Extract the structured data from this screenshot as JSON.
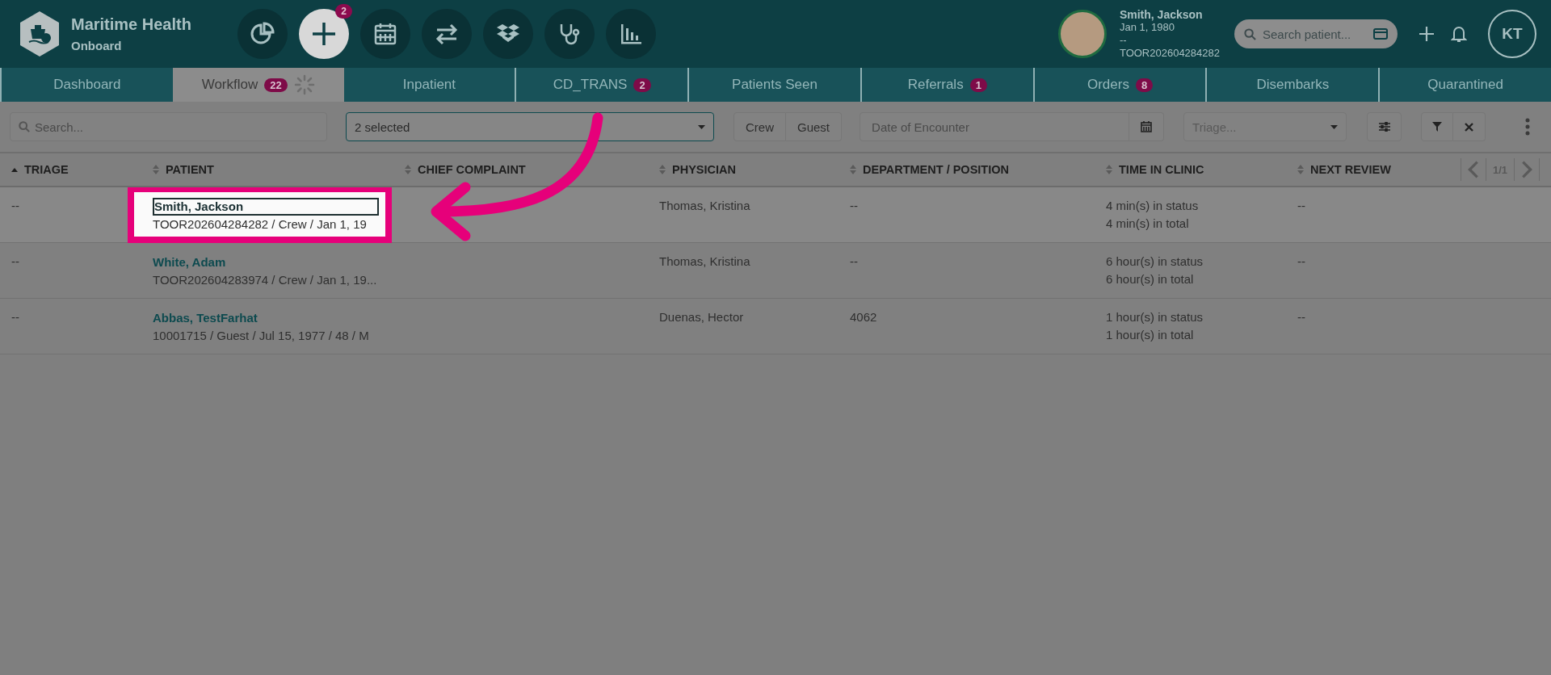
{
  "app": {
    "title": "Maritime Health",
    "subtitle": "Onboard"
  },
  "toolbar_buttons": [
    {
      "kind": "pie"
    },
    {
      "kind": "plus",
      "badge": "2"
    },
    {
      "kind": "calendar"
    },
    {
      "kind": "transfer"
    },
    {
      "kind": "boxes"
    },
    {
      "kind": "stethoscope"
    },
    {
      "kind": "bars"
    }
  ],
  "patient_banner": {
    "name": "Smith, Jackson",
    "dob": "Jan 1, 1980",
    "line_3": "--",
    "id": "TOOR202604284282"
  },
  "patient_search": {
    "placeholder": "Search patient..."
  },
  "user": {
    "initials": "KT"
  },
  "tabs": [
    {
      "label": "Dashboard",
      "selected": false,
      "loading": false
    },
    {
      "label": "Workflow",
      "badge": "22",
      "selected": true,
      "loading": true
    },
    {
      "label": "Inpatient",
      "selected": false,
      "loading": false
    },
    {
      "label": "CD_TRANS",
      "badge": "2",
      "selected": false,
      "loading": false
    },
    {
      "label": "Patients Seen",
      "selected": false,
      "loading": false
    },
    {
      "label": "Referrals",
      "badge": "1",
      "selected": false,
      "loading": false
    },
    {
      "label": "Orders",
      "badge": "8",
      "selected": false,
      "loading": false
    },
    {
      "label": "Disembarks",
      "selected": false,
      "loading": false
    },
    {
      "label": "Quarantined",
      "selected": false,
      "loading": false
    }
  ],
  "filters": {
    "search_placeholder": "Search...",
    "status_select": "2 selected",
    "type_buttons": [
      "Crew",
      "Guest"
    ],
    "date_placeholder": "Date of Encounter",
    "triage_placeholder": "Triage..."
  },
  "table": {
    "columns": [
      {
        "label": "TRIAGE",
        "sorted": true
      },
      {
        "label": "PATIENT",
        "sorted": false
      },
      {
        "label": "CHIEF COMPLAINT",
        "sorted": false
      },
      {
        "label": "PHYSICIAN",
        "sorted": false
      },
      {
        "label": "DEPARTMENT / POSITION",
        "sorted": false
      },
      {
        "label": "TIME IN CLINIC",
        "sorted": false
      },
      {
        "label": "NEXT REVIEW",
        "sorted": false
      }
    ],
    "pager": "1/1",
    "rows": [
      {
        "triage": "--",
        "patient_name": "Smith, Jackson",
        "patient_details": "TOOR202604284282 / Crew / Jan 1, 19",
        "physician": "Thomas, Kristina",
        "department": "--",
        "time_status": "4 min(s) in status",
        "time_total": "4 min(s) in total",
        "next_review": "--",
        "highlighted": true
      },
      {
        "triage": "--",
        "patient_name": "White, Adam",
        "patient_details": "TOOR202604283974 / Crew / Jan 1, 19...",
        "physician": "Thomas, Kristina",
        "department": "--",
        "time_status": "6 hour(s) in status",
        "time_total": "6 hour(s) in total",
        "next_review": "--",
        "highlighted": false
      },
      {
        "triage": "--",
        "patient_name": "Abbas, TestFarhat",
        "patient_details": "10001715 / Guest / Jul 15, 1977 / 48 / M",
        "physician": "Duenas, Hector",
        "department": "4062",
        "time_status": "1 hour(s) in status",
        "time_total": "1 hour(s) in total",
        "next_review": "--",
        "highlighted": false
      }
    ]
  }
}
